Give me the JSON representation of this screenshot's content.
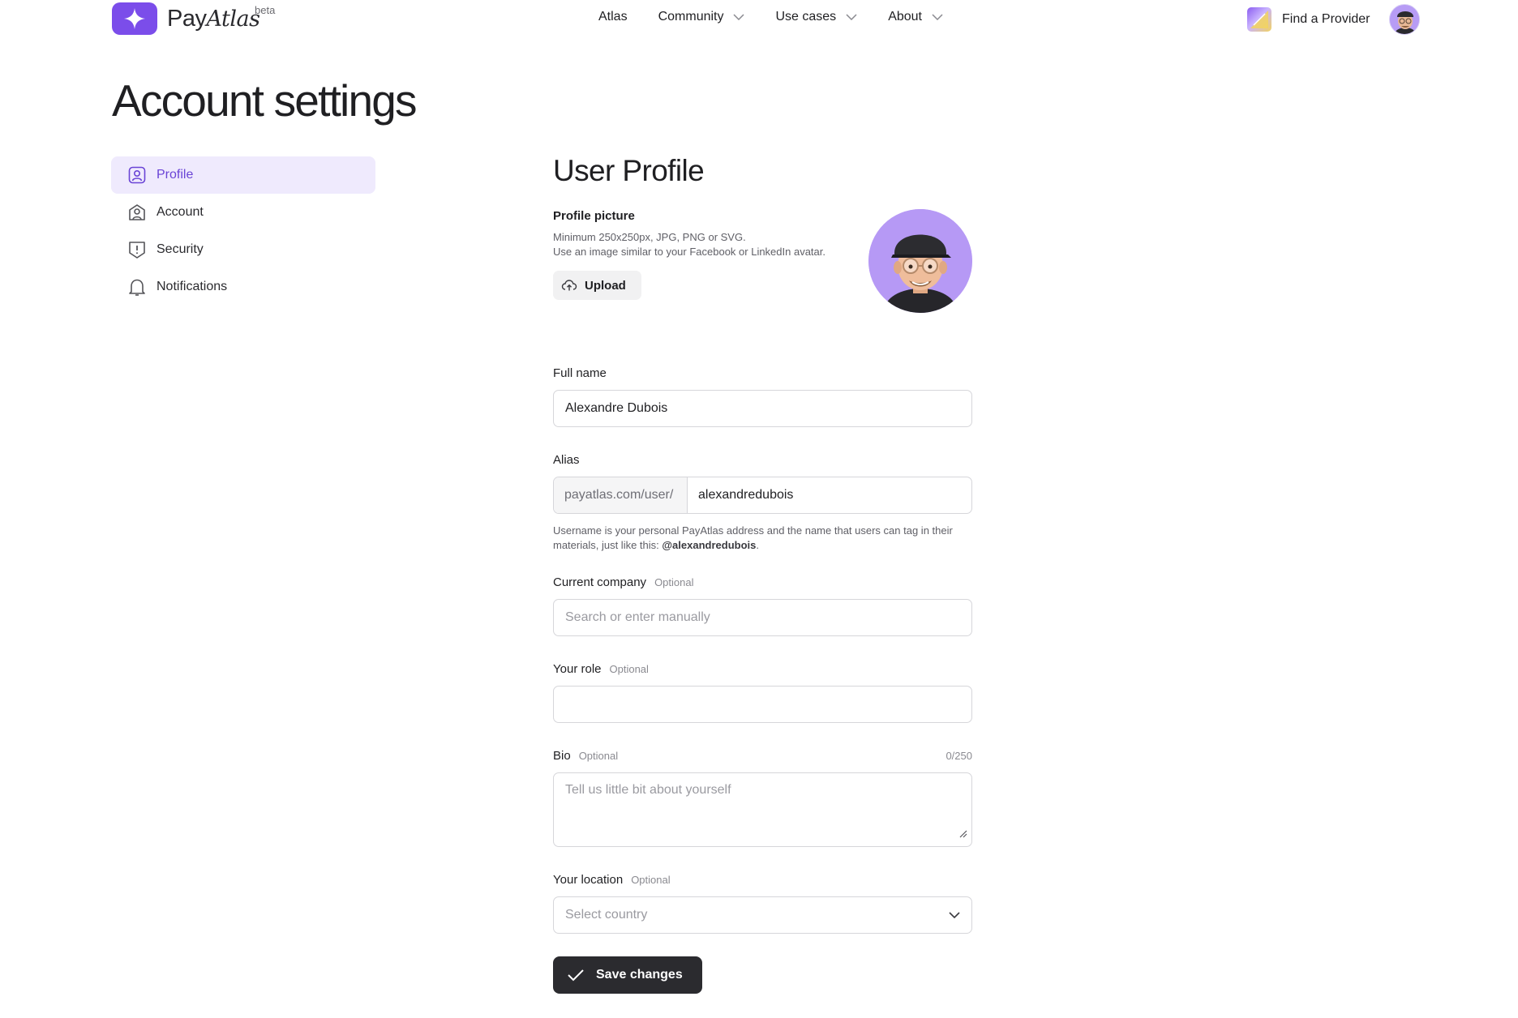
{
  "brand": {
    "name_plain": "Pay",
    "name_italic": "Atlas",
    "badge": "beta",
    "icon": "sparkle-icon",
    "color": "#7b4dea"
  },
  "nav": {
    "items": [
      {
        "label": "Atlas",
        "has_dropdown": false
      },
      {
        "label": "Community",
        "has_dropdown": true
      },
      {
        "label": "Use cases",
        "has_dropdown": true
      },
      {
        "label": "About",
        "has_dropdown": true
      }
    ],
    "find_provider": "Find a Provider"
  },
  "page_title": "Account settings",
  "sidebar": {
    "items": [
      {
        "label": "Profile",
        "icon": "profile-icon",
        "active": true
      },
      {
        "label": "Account",
        "icon": "account-icon",
        "active": false
      },
      {
        "label": "Security",
        "icon": "shield-alert-icon",
        "active": false
      },
      {
        "label": "Notifications",
        "icon": "bell-icon",
        "active": false
      }
    ]
  },
  "form": {
    "title": "User Profile",
    "picture": {
      "label": "Profile picture",
      "help_line1": "Minimum 250x250px, JPG, PNG or SVG.",
      "help_line2": "Use an image similar to your Facebook or LinkedIn avatar.",
      "upload_label": "Upload"
    },
    "full_name": {
      "label": "Full name",
      "value": "Alexandre Dubois"
    },
    "alias": {
      "label": "Alias",
      "prefix": "payatlas.com/user/",
      "value": "alexandredubois",
      "help_text": "Username is your personal PayAtlas address and the name that users can tag in their materials, just like this: ",
      "help_handle": "@alexandredubois",
      "help_end": "."
    },
    "company": {
      "label": "Current company",
      "optional": "Optional",
      "placeholder": "Search or enter manually",
      "value": ""
    },
    "role": {
      "label": "Your role",
      "optional": "Optional",
      "value": ""
    },
    "bio": {
      "label": "Bio",
      "optional": "Optional",
      "count": "0/250",
      "placeholder": "Tell us little bit about yourself"
    },
    "location": {
      "label": "Your location",
      "optional": "Optional",
      "placeholder": "Select country"
    },
    "save_label": "Save changes"
  },
  "colors": {
    "accent": "#7b4dea",
    "active_bg": "#efeafd",
    "active_text": "#6a44d6",
    "primary_button": "#2b2b2f"
  }
}
